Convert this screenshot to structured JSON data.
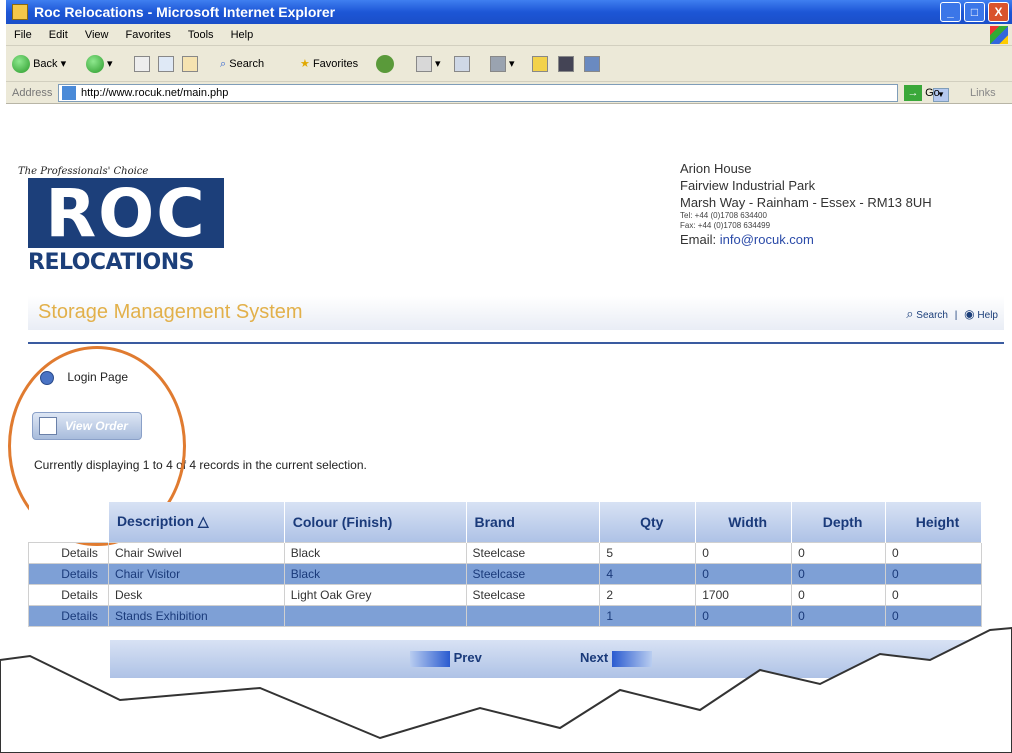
{
  "window": {
    "title": "Roc Relocations - Microsoft Internet Explorer",
    "minimize": "_",
    "maximize": "□",
    "close": "X"
  },
  "menu": [
    "File",
    "Edit",
    "View",
    "Favorites",
    "Tools",
    "Help"
  ],
  "toolbar": {
    "back": "Back",
    "search": "Search",
    "favorites": "Favorites"
  },
  "addressbar": {
    "label": "Address",
    "url": "http://www.rocuk.net/main.php",
    "go": "Go",
    "links": "Links"
  },
  "header": {
    "tagline": "The Professionals' Choice",
    "logo_main": "ROC",
    "logo_sub": "RELOCATIONS",
    "address_lines": [
      "Arion House",
      "Fairview Industrial Park",
      "Marsh Way - Rainham - Essex - RM13 8UH"
    ],
    "tel": "Tel: +44 (0)1708 634400",
    "fax": "Fax: +44 (0)1708 634499",
    "email_label": "Email:",
    "email": "info@rocuk.com"
  },
  "nav": {
    "title": "Storage Management System",
    "search": "Search",
    "separator": "|",
    "help": "Help"
  },
  "content": {
    "login_link": "Login Page",
    "view_order": "View Order",
    "display_text": "Currently displaying 1 to 4 of 4 records in the current selection."
  },
  "table": {
    "headers": [
      "",
      "Description △",
      "Colour (Finish)",
      "Brand",
      "Qty",
      "Width",
      "Depth",
      "Height"
    ],
    "rows": [
      [
        "Details",
        "Chair Swivel",
        "Black",
        "Steelcase",
        "5",
        "0",
        "0",
        "0"
      ],
      [
        "Details",
        "Chair Visitor",
        "Black",
        "Steelcase",
        "4",
        "0",
        "0",
        "0"
      ],
      [
        "Details",
        "Desk",
        "Light Oak Grey",
        "Steelcase",
        "2",
        "1700",
        "0",
        "0"
      ],
      [
        "Details",
        "Stands Exhibition",
        "",
        "",
        "1",
        "0",
        "0",
        "0"
      ]
    ]
  },
  "pager": {
    "prev": "Prev",
    "next": "Next"
  }
}
